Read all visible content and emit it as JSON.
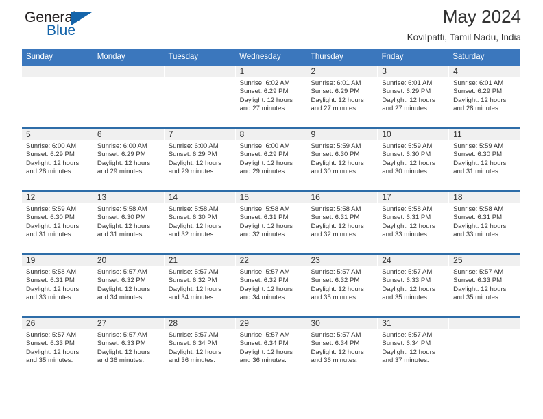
{
  "brand": {
    "word1": "General",
    "word2": "Blue",
    "triangle_color": "#1464aa",
    "text_color": "#231f20"
  },
  "header": {
    "title": "May 2024",
    "subtitle": "Kovilpatti, Tamil Nadu, India"
  },
  "theme": {
    "header_blue": "#3b77bd",
    "week_divider_blue": "#2e6da8",
    "daynum_band": "#f0f0f0",
    "text": "#333333"
  },
  "calendar": {
    "day_headers": [
      "Sunday",
      "Monday",
      "Tuesday",
      "Wednesday",
      "Thursday",
      "Friday",
      "Saturday"
    ],
    "weeks": [
      [
        {
          "day": "",
          "empty": true,
          "sunrise": "",
          "sunset": "",
          "daylight_1": "",
          "daylight_2": ""
        },
        {
          "day": "",
          "empty": true,
          "sunrise": "",
          "sunset": "",
          "daylight_1": "",
          "daylight_2": ""
        },
        {
          "day": "",
          "empty": true,
          "sunrise": "",
          "sunset": "",
          "daylight_1": "",
          "daylight_2": ""
        },
        {
          "day": "1",
          "sunrise": "Sunrise: 6:02 AM",
          "sunset": "Sunset: 6:29 PM",
          "daylight_1": "Daylight: 12 hours",
          "daylight_2": "and 27 minutes."
        },
        {
          "day": "2",
          "sunrise": "Sunrise: 6:01 AM",
          "sunset": "Sunset: 6:29 PM",
          "daylight_1": "Daylight: 12 hours",
          "daylight_2": "and 27 minutes."
        },
        {
          "day": "3",
          "sunrise": "Sunrise: 6:01 AM",
          "sunset": "Sunset: 6:29 PM",
          "daylight_1": "Daylight: 12 hours",
          "daylight_2": "and 27 minutes."
        },
        {
          "day": "4",
          "sunrise": "Sunrise: 6:01 AM",
          "sunset": "Sunset: 6:29 PM",
          "daylight_1": "Daylight: 12 hours",
          "daylight_2": "and 28 minutes."
        }
      ],
      [
        {
          "day": "5",
          "sunrise": "Sunrise: 6:00 AM",
          "sunset": "Sunset: 6:29 PM",
          "daylight_1": "Daylight: 12 hours",
          "daylight_2": "and 28 minutes."
        },
        {
          "day": "6",
          "sunrise": "Sunrise: 6:00 AM",
          "sunset": "Sunset: 6:29 PM",
          "daylight_1": "Daylight: 12 hours",
          "daylight_2": "and 29 minutes."
        },
        {
          "day": "7",
          "sunrise": "Sunrise: 6:00 AM",
          "sunset": "Sunset: 6:29 PM",
          "daylight_1": "Daylight: 12 hours",
          "daylight_2": "and 29 minutes."
        },
        {
          "day": "8",
          "sunrise": "Sunrise: 6:00 AM",
          "sunset": "Sunset: 6:29 PM",
          "daylight_1": "Daylight: 12 hours",
          "daylight_2": "and 29 minutes."
        },
        {
          "day": "9",
          "sunrise": "Sunrise: 5:59 AM",
          "sunset": "Sunset: 6:30 PM",
          "daylight_1": "Daylight: 12 hours",
          "daylight_2": "and 30 minutes."
        },
        {
          "day": "10",
          "sunrise": "Sunrise: 5:59 AM",
          "sunset": "Sunset: 6:30 PM",
          "daylight_1": "Daylight: 12 hours",
          "daylight_2": "and 30 minutes."
        },
        {
          "day": "11",
          "sunrise": "Sunrise: 5:59 AM",
          "sunset": "Sunset: 6:30 PM",
          "daylight_1": "Daylight: 12 hours",
          "daylight_2": "and 31 minutes."
        }
      ],
      [
        {
          "day": "12",
          "sunrise": "Sunrise: 5:59 AM",
          "sunset": "Sunset: 6:30 PM",
          "daylight_1": "Daylight: 12 hours",
          "daylight_2": "and 31 minutes."
        },
        {
          "day": "13",
          "sunrise": "Sunrise: 5:58 AM",
          "sunset": "Sunset: 6:30 PM",
          "daylight_1": "Daylight: 12 hours",
          "daylight_2": "and 31 minutes."
        },
        {
          "day": "14",
          "sunrise": "Sunrise: 5:58 AM",
          "sunset": "Sunset: 6:30 PM",
          "daylight_1": "Daylight: 12 hours",
          "daylight_2": "and 32 minutes."
        },
        {
          "day": "15",
          "sunrise": "Sunrise: 5:58 AM",
          "sunset": "Sunset: 6:31 PM",
          "daylight_1": "Daylight: 12 hours",
          "daylight_2": "and 32 minutes."
        },
        {
          "day": "16",
          "sunrise": "Sunrise: 5:58 AM",
          "sunset": "Sunset: 6:31 PM",
          "daylight_1": "Daylight: 12 hours",
          "daylight_2": "and 32 minutes."
        },
        {
          "day": "17",
          "sunrise": "Sunrise: 5:58 AM",
          "sunset": "Sunset: 6:31 PM",
          "daylight_1": "Daylight: 12 hours",
          "daylight_2": "and 33 minutes."
        },
        {
          "day": "18",
          "sunrise": "Sunrise: 5:58 AM",
          "sunset": "Sunset: 6:31 PM",
          "daylight_1": "Daylight: 12 hours",
          "daylight_2": "and 33 minutes."
        }
      ],
      [
        {
          "day": "19",
          "sunrise": "Sunrise: 5:58 AM",
          "sunset": "Sunset: 6:31 PM",
          "daylight_1": "Daylight: 12 hours",
          "daylight_2": "and 33 minutes."
        },
        {
          "day": "20",
          "sunrise": "Sunrise: 5:57 AM",
          "sunset": "Sunset: 6:32 PM",
          "daylight_1": "Daylight: 12 hours",
          "daylight_2": "and 34 minutes."
        },
        {
          "day": "21",
          "sunrise": "Sunrise: 5:57 AM",
          "sunset": "Sunset: 6:32 PM",
          "daylight_1": "Daylight: 12 hours",
          "daylight_2": "and 34 minutes."
        },
        {
          "day": "22",
          "sunrise": "Sunrise: 5:57 AM",
          "sunset": "Sunset: 6:32 PM",
          "daylight_1": "Daylight: 12 hours",
          "daylight_2": "and 34 minutes."
        },
        {
          "day": "23",
          "sunrise": "Sunrise: 5:57 AM",
          "sunset": "Sunset: 6:32 PM",
          "daylight_1": "Daylight: 12 hours",
          "daylight_2": "and 35 minutes."
        },
        {
          "day": "24",
          "sunrise": "Sunrise: 5:57 AM",
          "sunset": "Sunset: 6:33 PM",
          "daylight_1": "Daylight: 12 hours",
          "daylight_2": "and 35 minutes."
        },
        {
          "day": "25",
          "sunrise": "Sunrise: 5:57 AM",
          "sunset": "Sunset: 6:33 PM",
          "daylight_1": "Daylight: 12 hours",
          "daylight_2": "and 35 minutes."
        }
      ],
      [
        {
          "day": "26",
          "sunrise": "Sunrise: 5:57 AM",
          "sunset": "Sunset: 6:33 PM",
          "daylight_1": "Daylight: 12 hours",
          "daylight_2": "and 35 minutes."
        },
        {
          "day": "27",
          "sunrise": "Sunrise: 5:57 AM",
          "sunset": "Sunset: 6:33 PM",
          "daylight_1": "Daylight: 12 hours",
          "daylight_2": "and 36 minutes."
        },
        {
          "day": "28",
          "sunrise": "Sunrise: 5:57 AM",
          "sunset": "Sunset: 6:34 PM",
          "daylight_1": "Daylight: 12 hours",
          "daylight_2": "and 36 minutes."
        },
        {
          "day": "29",
          "sunrise": "Sunrise: 5:57 AM",
          "sunset": "Sunset: 6:34 PM",
          "daylight_1": "Daylight: 12 hours",
          "daylight_2": "and 36 minutes."
        },
        {
          "day": "30",
          "sunrise": "Sunrise: 5:57 AM",
          "sunset": "Sunset: 6:34 PM",
          "daylight_1": "Daylight: 12 hours",
          "daylight_2": "and 36 minutes."
        },
        {
          "day": "31",
          "sunrise": "Sunrise: 5:57 AM",
          "sunset": "Sunset: 6:34 PM",
          "daylight_1": "Daylight: 12 hours",
          "daylight_2": "and 37 minutes."
        },
        {
          "day": "",
          "empty": true,
          "sunrise": "",
          "sunset": "",
          "daylight_1": "",
          "daylight_2": ""
        }
      ]
    ]
  }
}
